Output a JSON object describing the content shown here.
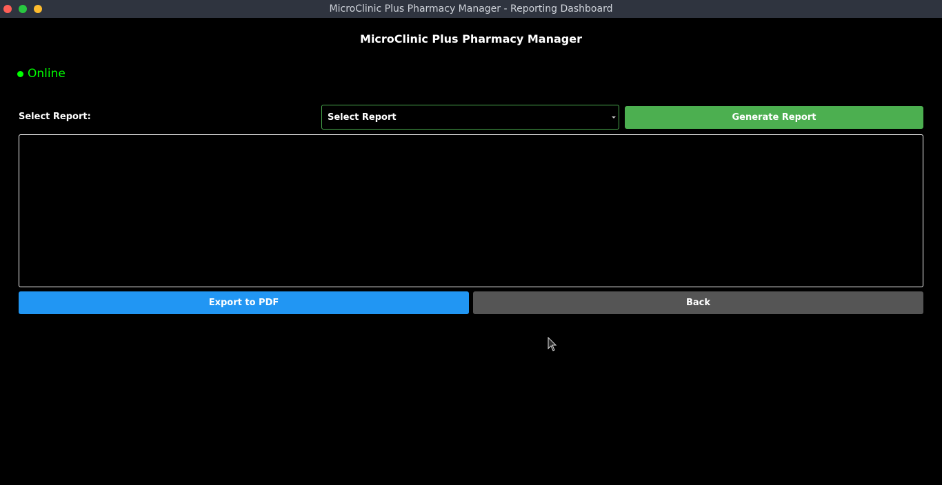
{
  "window": {
    "title": "MicroClinic Plus Pharmacy Manager - Reporting Dashboard"
  },
  "app": {
    "title": "MicroClinic Plus Pharmacy Manager"
  },
  "status": {
    "text": "Online",
    "color": "#00ff00"
  },
  "report": {
    "label": "Select Report:",
    "select_value": "Select Report",
    "generate_label": "Generate Report",
    "output_text": ""
  },
  "actions": {
    "export_label": "Export to PDF",
    "back_label": "Back"
  },
  "colors": {
    "generate": "#4caf50",
    "export": "#2196f3",
    "back": "#555555",
    "background": "#000000"
  }
}
